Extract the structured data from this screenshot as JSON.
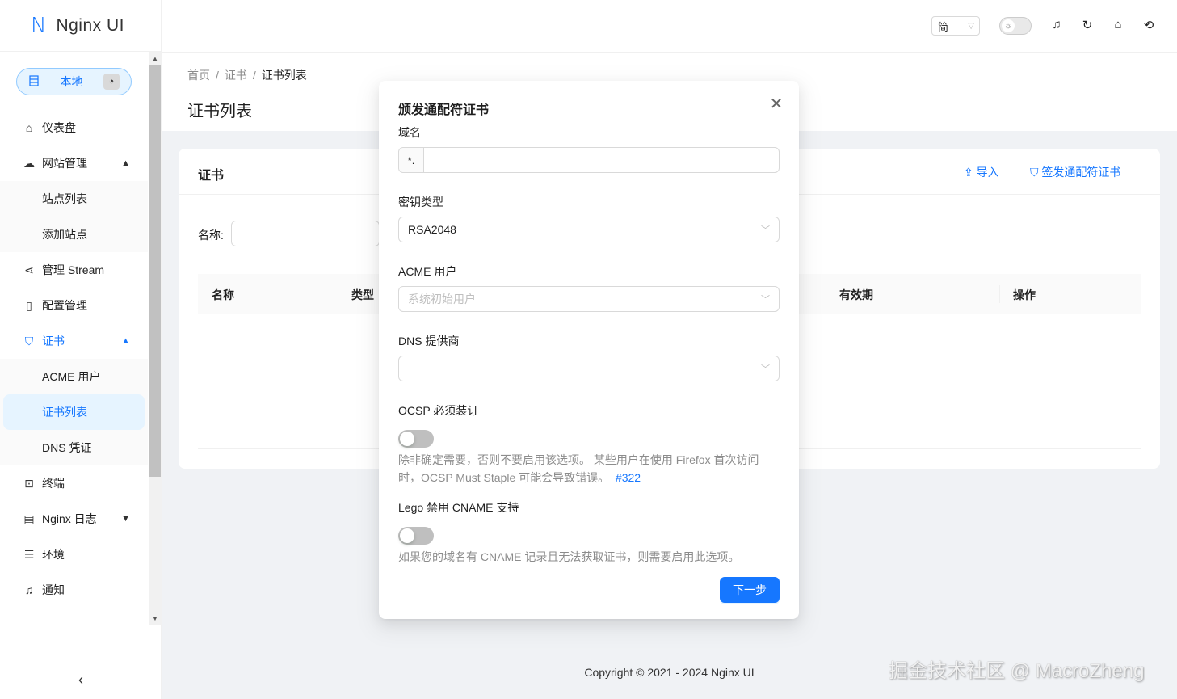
{
  "app": {
    "logo_letter": "N",
    "name": "Nginx UI"
  },
  "env": {
    "label": "本地"
  },
  "sidebar": {
    "items": [
      {
        "label": "仪表盘"
      },
      {
        "label": "网站管理"
      },
      {
        "label": "站点列表"
      },
      {
        "label": "添加站点"
      },
      {
        "label": "管理 Stream"
      },
      {
        "label": "配置管理"
      },
      {
        "label": "证书"
      },
      {
        "label": "ACME 用户"
      },
      {
        "label": "证书列表"
      },
      {
        "label": "DNS 凭证"
      },
      {
        "label": "终端"
      },
      {
        "label": "Nginx 日志"
      },
      {
        "label": "环境"
      },
      {
        "label": "通知"
      }
    ]
  },
  "header": {
    "lang": "简"
  },
  "breadcrumb": {
    "home": "首页",
    "cert": "证书",
    "current": "证书列表"
  },
  "page": {
    "title": "证书列表"
  },
  "card": {
    "title": "证书",
    "import_label": "导入",
    "issue_label": "签发通配符证书",
    "name_label": "名称:",
    "columns": [
      "名称",
      "类型",
      "有效期",
      "操作"
    ]
  },
  "modal": {
    "title": "颁发通配符证书",
    "domain_label": "域名",
    "domain_prefix": "*.",
    "domain_value": "",
    "key_type_label": "密钥类型",
    "key_type_value": "RSA2048",
    "acme_user_label": "ACME 用户",
    "acme_user_placeholder": "系统初始用户",
    "dns_label": "DNS 提供商",
    "dns_value": "",
    "ocsp_label": "OCSP 必须装订",
    "ocsp_enabled": false,
    "ocsp_help": "除非确定需要，否则不要启用该选项。 某些用户在使用 Firefox 首次访问时，OCSP Must Staple 可能会导致错误。",
    "ocsp_help_link": "#322",
    "lego_label": "Lego 禁用 CNAME 支持",
    "lego_enabled": false,
    "lego_help": "如果您的域名有 CNAME 记录且无法获取证书，则需要启用此选项。",
    "next_label": "下一步"
  },
  "footer": {
    "copyright": "Copyright © 2021 - 2024 Nginx UI"
  },
  "watermark": "掘金技术社区 @ MacroZheng",
  "colors": {
    "primary": "#1677ff",
    "bg": "#f0f2f5",
    "switch_off": "#bfbfbf"
  }
}
